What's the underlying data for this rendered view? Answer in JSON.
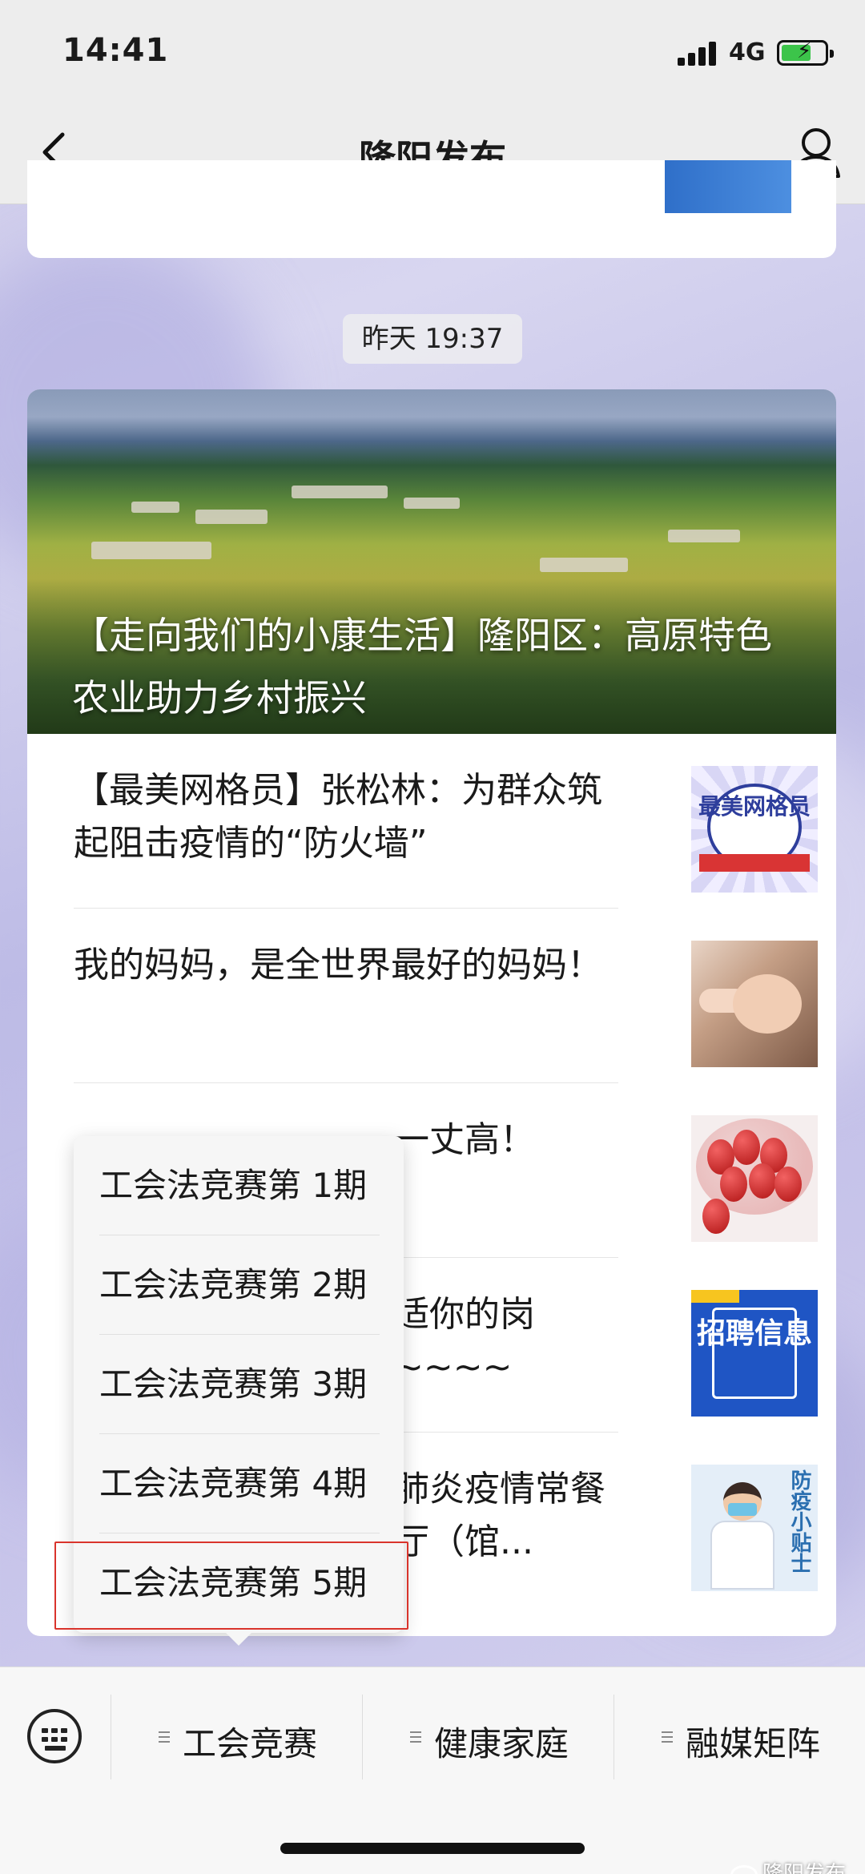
{
  "status_bar": {
    "time": "14:41",
    "network": "4G",
    "battery_charging": true
  },
  "nav": {
    "title": "隆阳发布",
    "back_icon": "chevron-left-icon",
    "profile_icon": "person-icon"
  },
  "timestamp": "昨天 19:37",
  "hero": {
    "title": "【走向我们的小康生活】隆阳区：高原特色农业助力乡村振兴"
  },
  "articles": [
    {
      "title": "【最美网格员】张松林：为群众筑起阻击疫情的“防火墙”",
      "thumb_text": "最美网格员"
    },
    {
      "title": "我的妈妈，是全世界最好的妈妈！"
    },
    {
      "title": "一丈高！"
    },
    {
      "title": "适你的岗~~~~",
      "thumb_text": "招聘信息"
    },
    {
      "title": "肺炎疫情常餐厅（馆...",
      "thumb_text": "防疫小贴士"
    }
  ],
  "popup_menu": {
    "items": [
      "工会法竞赛第 1期",
      "工会法竞赛第 2期",
      "工会法竞赛第 3期",
      "工会法竞赛第 4期",
      "工会法竞赛第 5期"
    ],
    "highlighted_index": 4
  },
  "bottom_menu": {
    "keyboard_icon": "keyboard-icon",
    "items": [
      "工会竞赛",
      "健康家庭",
      "融媒矩阵"
    ]
  },
  "watermark": "隆阳发布",
  "colors": {
    "highlight": "#d9342c",
    "accent_blue": "#1f55c4",
    "battery_green": "#3cc44a"
  }
}
